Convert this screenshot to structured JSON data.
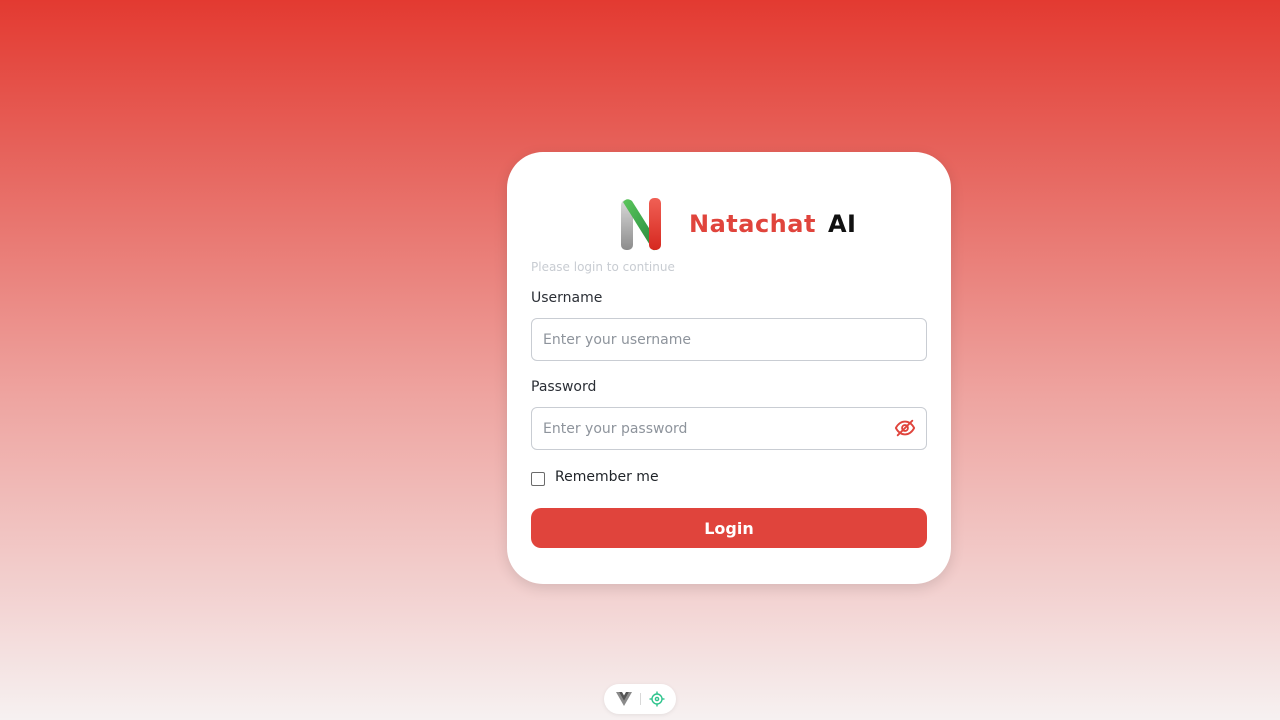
{
  "brand": {
    "name_primary": "Natachat",
    "name_secondary": "AI",
    "logo_icon": "natachat-n-logo-icon"
  },
  "login": {
    "subtitle": "Please login to continue",
    "username_label": "Username",
    "username_placeholder": "Enter your username",
    "username_value": "",
    "password_label": "Password",
    "password_placeholder": "Enter your password",
    "password_value": "",
    "password_toggle_icon": "eye-off-icon",
    "remember_label": "Remember me",
    "remember_checked": false,
    "submit_label": "Login"
  },
  "devtools": {
    "icons": [
      "vue-logo-icon",
      "crosshair-icon"
    ]
  },
  "colors": {
    "accent": "#e0443c",
    "background_top": "#e33a31",
    "background_bottom": "#f6f1f1"
  }
}
